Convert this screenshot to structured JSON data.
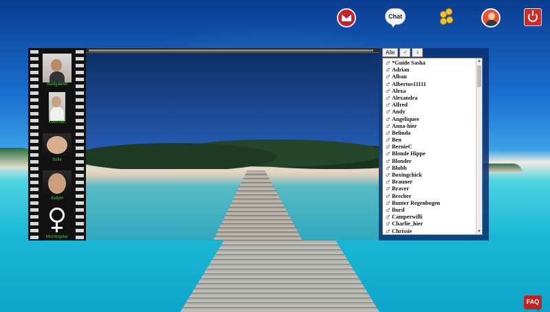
{
  "top_icons": {
    "mail": "mail-icon",
    "chat_label": "Chat",
    "coins": "coins-icon",
    "profile": "user-avatar-icon",
    "logout": "power-icon"
  },
  "filmstrip": {
    "users": [
      {
        "name": "vladigabriel"
      },
      {
        "name": "Kevinhler"
      },
      {
        "name": "Sofie"
      },
      {
        "name": "KellyH"
      },
      {
        "name": "Morningstar"
      }
    ]
  },
  "userlist": {
    "tabs": [
      "Alle",
      "♂",
      "♀"
    ],
    "users": [
      "*Guide Sasha",
      "Adrian",
      "Alban",
      "Albertus11111",
      "Alexa",
      "Alexandra",
      "Alfred",
      "Andy",
      "Angeliquee",
      "Anna-hier",
      "Belinda",
      "Ben",
      "BernieC",
      "Blonde Hippe",
      "Blonder",
      "Blubb",
      "Boxingchick",
      "Brauner",
      "Braver",
      "Brecher",
      "Bunter Regenbogen",
      "Burd",
      "Camperwilli",
      "Charlie_hier",
      "Chrissie"
    ]
  },
  "faq_label": "FAQ",
  "colors": {
    "accent_red": "#c42020",
    "name_green": "#3cd63c"
  }
}
